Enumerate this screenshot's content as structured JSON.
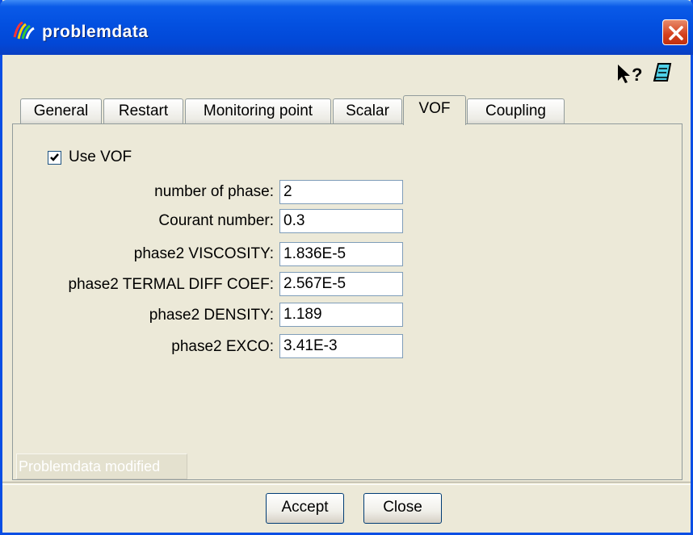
{
  "window": {
    "title": "problemdata",
    "icon": "app-icon",
    "close_icon": "close-icon"
  },
  "toolbar": {
    "help_icon": "whats-this-icon",
    "help_glyph": "?",
    "note_icon": "notepad-icon"
  },
  "tabs": [
    {
      "label": "General",
      "active": false
    },
    {
      "label": "Restart",
      "active": false
    },
    {
      "label": "Monitoring point",
      "active": false
    },
    {
      "label": "Scalar",
      "active": false
    },
    {
      "label": "VOF",
      "active": true
    },
    {
      "label": "Coupling",
      "active": false
    }
  ],
  "vof": {
    "use_vof_label": "Use VOF",
    "use_vof_checked": true,
    "fields": [
      {
        "label": "number of phase:",
        "value": "2"
      },
      {
        "label": "Courant number:",
        "value": "0.3"
      },
      {
        "label": "phase2 VISCOSITY:",
        "value": "1.836E-5"
      },
      {
        "label": "phase2 TERMAL DIFF COEF:",
        "value": "2.567E-5"
      },
      {
        "label": "phase2 DENSITY:",
        "value": "1.189"
      },
      {
        "label": "phase2 EXCO:",
        "value": "3.41E-3"
      }
    ]
  },
  "status": {
    "text": "Problemdata modified"
  },
  "buttons": {
    "accept_label": "Accept",
    "close_label": "Close"
  }
}
